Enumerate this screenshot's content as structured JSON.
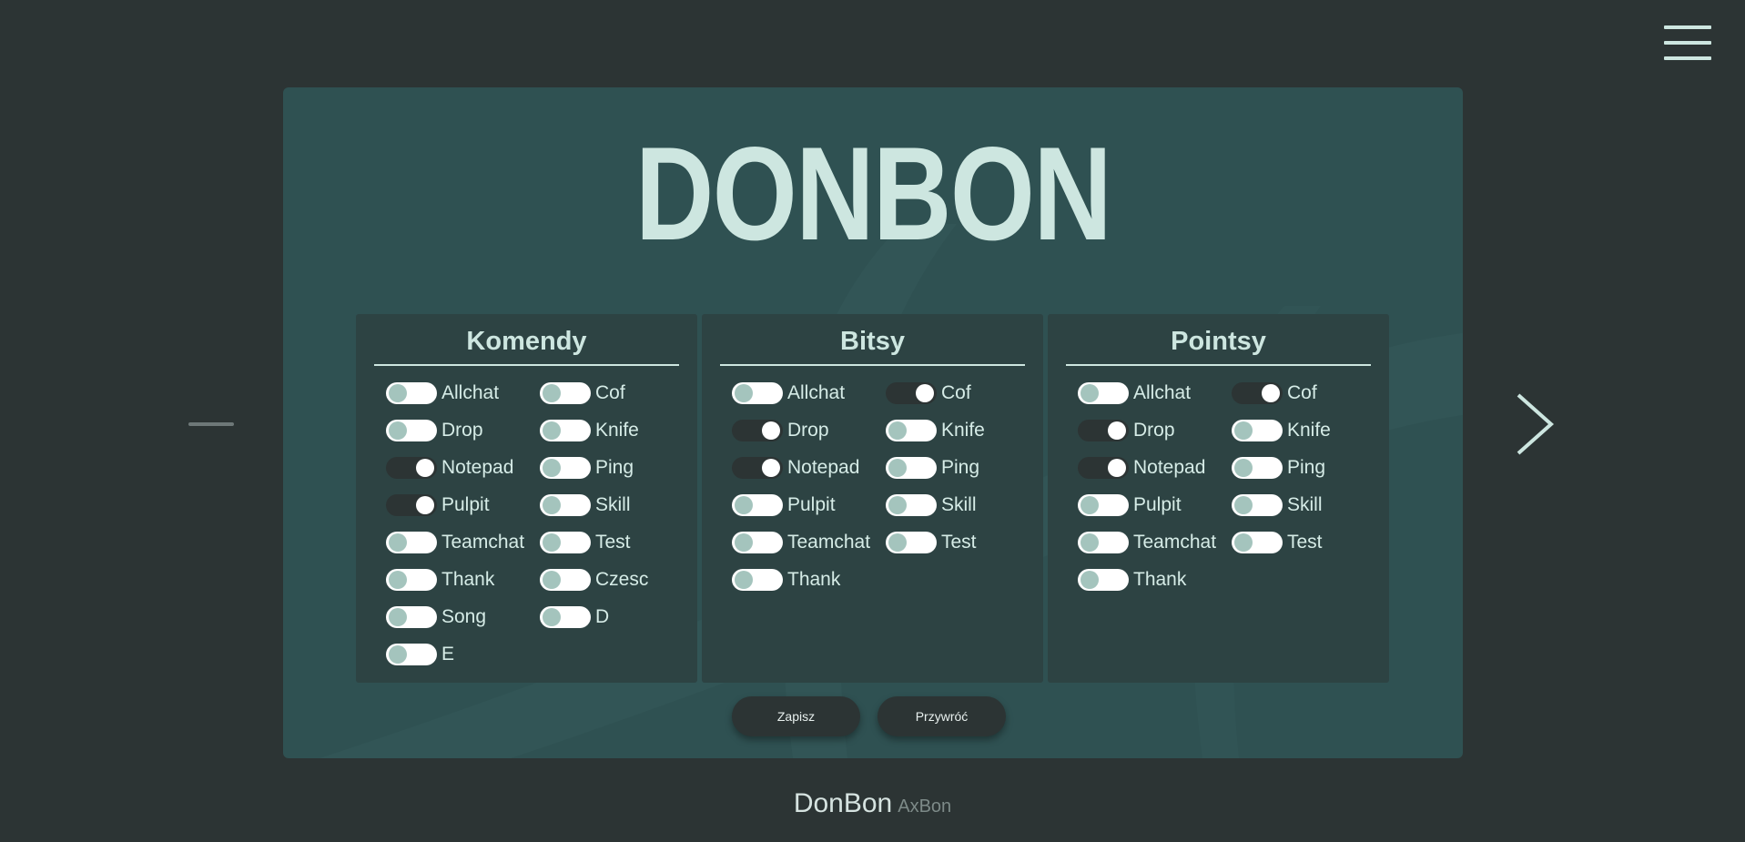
{
  "title": "DONBON",
  "menu_icon": "hamburger-icon",
  "nav": {
    "prev_icon": "minus-dash-icon",
    "next_icon": "chevron-right-icon"
  },
  "panels": [
    {
      "heading": "Komendy",
      "left": [
        {
          "label": "Allchat",
          "on": false
        },
        {
          "label": "Drop",
          "on": false
        },
        {
          "label": "Notepad",
          "on": true
        },
        {
          "label": "Pulpit",
          "on": true
        },
        {
          "label": "Teamchat",
          "on": false
        },
        {
          "label": "Thank",
          "on": false
        },
        {
          "label": "Song",
          "on": false
        },
        {
          "label": "E",
          "on": false
        }
      ],
      "right": [
        {
          "label": "Cof",
          "on": false
        },
        {
          "label": "Knife",
          "on": false
        },
        {
          "label": "Ping",
          "on": false
        },
        {
          "label": "Skill",
          "on": false
        },
        {
          "label": "Test",
          "on": false
        },
        {
          "label": "Czesc",
          "on": false
        },
        {
          "label": "D",
          "on": false
        }
      ]
    },
    {
      "heading": "Bitsy",
      "left": [
        {
          "label": "Allchat",
          "on": false
        },
        {
          "label": "Drop",
          "on": true
        },
        {
          "label": "Notepad",
          "on": true
        },
        {
          "label": "Pulpit",
          "on": false
        },
        {
          "label": "Teamchat",
          "on": false
        },
        {
          "label": "Thank",
          "on": false
        }
      ],
      "right": [
        {
          "label": "Cof",
          "on": true
        },
        {
          "label": "Knife",
          "on": false
        },
        {
          "label": "Ping",
          "on": false
        },
        {
          "label": "Skill",
          "on": false
        },
        {
          "label": "Test",
          "on": false
        }
      ]
    },
    {
      "heading": "Pointsy",
      "left": [
        {
          "label": "Allchat",
          "on": false
        },
        {
          "label": "Drop",
          "on": true
        },
        {
          "label": "Notepad",
          "on": true
        },
        {
          "label": "Pulpit",
          "on": false
        },
        {
          "label": "Teamchat",
          "on": false
        },
        {
          "label": "Thank",
          "on": false
        }
      ],
      "right": [
        {
          "label": "Cof",
          "on": true
        },
        {
          "label": "Knife",
          "on": false
        },
        {
          "label": "Ping",
          "on": false
        },
        {
          "label": "Skill",
          "on": false
        },
        {
          "label": "Test",
          "on": false
        }
      ]
    }
  ],
  "buttons": {
    "save": "Zapisz",
    "restore": "Przywróć"
  },
  "footer": {
    "brand": "DonBon",
    "sub": "AxBon"
  },
  "colors": {
    "background": "#2c3434",
    "card": "#2f5152",
    "panel": "#2d4343",
    "accent_text": "#cde6e0"
  }
}
